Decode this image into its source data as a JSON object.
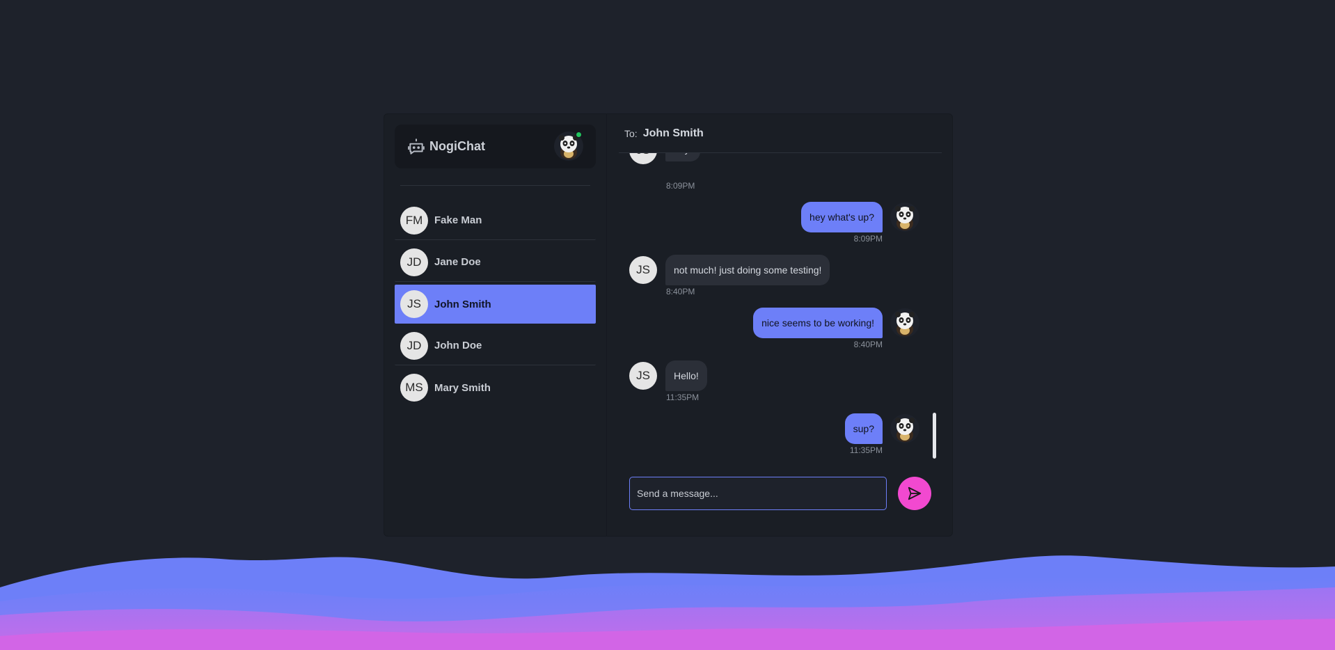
{
  "app": {
    "name": "NogiChat"
  },
  "contacts": [
    {
      "initials": "FM",
      "name": "Fake Man",
      "active": false
    },
    {
      "initials": "JD",
      "name": "Jane Doe",
      "active": false
    },
    {
      "initials": "JS",
      "name": "John Smith",
      "active": true
    },
    {
      "initials": "JD",
      "name": "John Doe",
      "active": false
    },
    {
      "initials": "MS",
      "name": "Mary Smith",
      "active": false
    }
  ],
  "chat": {
    "to_label": "To:",
    "to_name": "John Smith",
    "messages": [
      {
        "direction": "in",
        "initials": "JS",
        "text": "hey!",
        "time": "8:09PM"
      },
      {
        "direction": "out",
        "text": "hey what's up?",
        "time": "8:09PM"
      },
      {
        "direction": "in",
        "initials": "JS",
        "text": "not much! just doing some testing!",
        "time": "8:40PM"
      },
      {
        "direction": "out",
        "text": "nice seems to be working!",
        "time": "8:40PM"
      },
      {
        "direction": "in",
        "initials": "JS",
        "text": "Hello!",
        "time": "11:35PM"
      },
      {
        "direction": "out",
        "text": "sup?",
        "time": "11:35PM"
      }
    ],
    "composer_placeholder": "Send a message..."
  },
  "colors": {
    "accent": "#6d7ff8",
    "send": "#f249d0",
    "online": "#22c55e",
    "background": "#1e222b"
  },
  "icons": {
    "brand": "bot-icon",
    "send": "send-icon"
  }
}
